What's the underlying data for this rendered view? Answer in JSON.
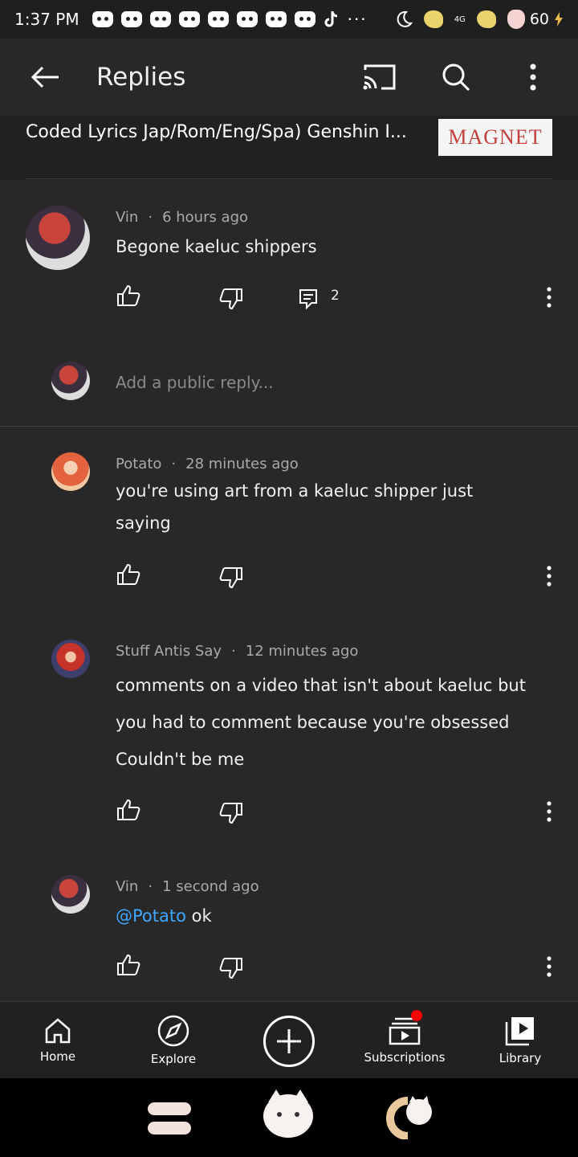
{
  "status_bar": {
    "time": "1:37 PM",
    "network": "4G",
    "battery": "60",
    "icons": [
      "discord-icon",
      "discord-icon",
      "discord-icon",
      "discord-icon",
      "discord-icon",
      "discord-icon",
      "discord-icon",
      "discord-icon",
      "tiktok-icon",
      "more-notifications-icon",
      "dnd-moon-icon",
      "duck-icon",
      "signal-icon",
      "duck-icon",
      "paw-battery-icon",
      "charging-icon"
    ]
  },
  "app_bar": {
    "title": "Replies",
    "icons": [
      "back-arrow-icon",
      "cast-icon",
      "search-icon",
      "more-vert-icon"
    ]
  },
  "video": {
    "title": "Coded Lyrics Jap/Rom/Eng/Spa) Genshin I...",
    "thumb_text": "MAGNET"
  },
  "parent_comment": {
    "author": "Vin",
    "time": "6 hours ago",
    "text": "Begone kaeluc shippers",
    "reply_count": "2"
  },
  "reply_box": {
    "placeholder": "Add a public reply..."
  },
  "replies": [
    {
      "author": "Potato",
      "time": "28 minutes ago",
      "lines": [
        "you're using art from a kaeluc shipper just",
        "saying"
      ]
    },
    {
      "author": "Stuff Antis Say",
      "time": "12 minutes ago",
      "lines": [
        "comments on a video that isn't about kaeluc but",
        "you had to comment because you're obsessed",
        "Couldn't be me"
      ]
    },
    {
      "author": "Vin",
      "time": "1 second ago",
      "mention": "@Potato",
      "text": " ok"
    }
  ],
  "separator": "·",
  "bottom_nav": {
    "home": "Home",
    "explore": "Explore",
    "subscriptions": "Subscriptions",
    "library": "Library"
  },
  "colors": {
    "background": "#282828",
    "mention": "#3ea6ff",
    "badge": "#ff0000"
  }
}
